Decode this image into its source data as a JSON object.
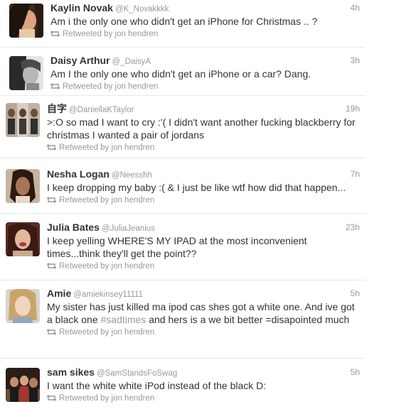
{
  "tweets": [
    {
      "fullname": "Kaylin Novak",
      "username": "@K_Novakkkk",
      "time": "4h",
      "text": "Am i the only one who didn't get an iPhone for Christmas .. ?",
      "context": "Retweeted by jon hendren"
    },
    {
      "fullname": "Daisy Arthur",
      "username": "@_DaisyA",
      "time": "3h",
      "text": "Am I the only one who didn't get an iPhone or a car? Dang.",
      "context": "Retweeted by jon hendren"
    },
    {
      "fullname": "自字",
      "username": "@DaniellaKTaylor",
      "time": "19h",
      "text": ">:O so mad I want to cry :'( I didn't want another fucking blackberry for christmas I wanted a pair of jordans",
      "context": "Retweeted by jon hendren"
    },
    {
      "fullname": "Nesha Logan",
      "username": "@Neesshh",
      "time": "7h",
      "text": "I keep dropping my baby :( & I just be like wtf how did that happen...",
      "context": "Retweeted by jon hendren"
    },
    {
      "fullname": "Julia Bates",
      "username": "@JuliaJeanius",
      "time": "23h",
      "text": "I keep yelling WHERE'S MY IPAD at the most inconvenient times...think they'll get the point??",
      "context": "Retweeted by jon hendren"
    },
    {
      "fullname": "Amie",
      "username": "@amiekinsey11111",
      "time": "5h",
      "text_before": "My sister has just killed ma ipod cas shes got a white one. And ive got a black one ",
      "hashtag": "#sadtimes",
      "text_after": " and hers is a we bit better =disapointed much",
      "context": "Retweeted by jon hendren"
    },
    {
      "fullname": "sam sikes",
      "username": "@SamStandsFoSwag",
      "time": "5h",
      "text": "I want the white white iPod instead of the black D:",
      "context": "Retweeted by jon hendren"
    }
  ],
  "icons": {
    "retweet": "retweet-icon"
  },
  "colors": {
    "text": "#333333",
    "meta": "#999999",
    "divider": "#e8e8e8"
  }
}
